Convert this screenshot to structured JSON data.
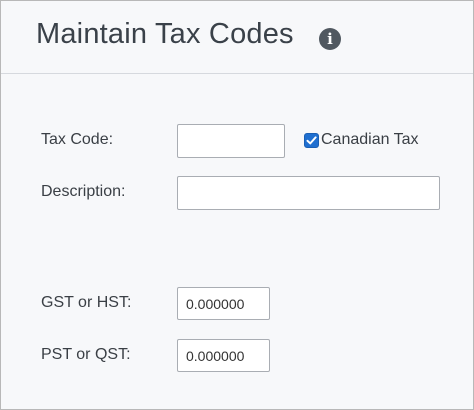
{
  "header": {
    "title": "Maintain Tax Codes",
    "info_glyph": "i"
  },
  "form": {
    "tax_code": {
      "label": "Tax Code:",
      "value": ""
    },
    "canadian_tax": {
      "label": "Canadian Tax",
      "checked": true
    },
    "description": {
      "label": "Description:",
      "value": ""
    },
    "gst_hst": {
      "label": "GST or HST:",
      "value": "0.000000"
    },
    "pst_qst": {
      "label": "PST or QST:",
      "value": "0.000000"
    }
  },
  "colors": {
    "checkbox_accent": "#1f6fd0",
    "background": "#f7f8fa"
  },
  "icons": {
    "info": "info-icon",
    "check": "check-icon"
  }
}
